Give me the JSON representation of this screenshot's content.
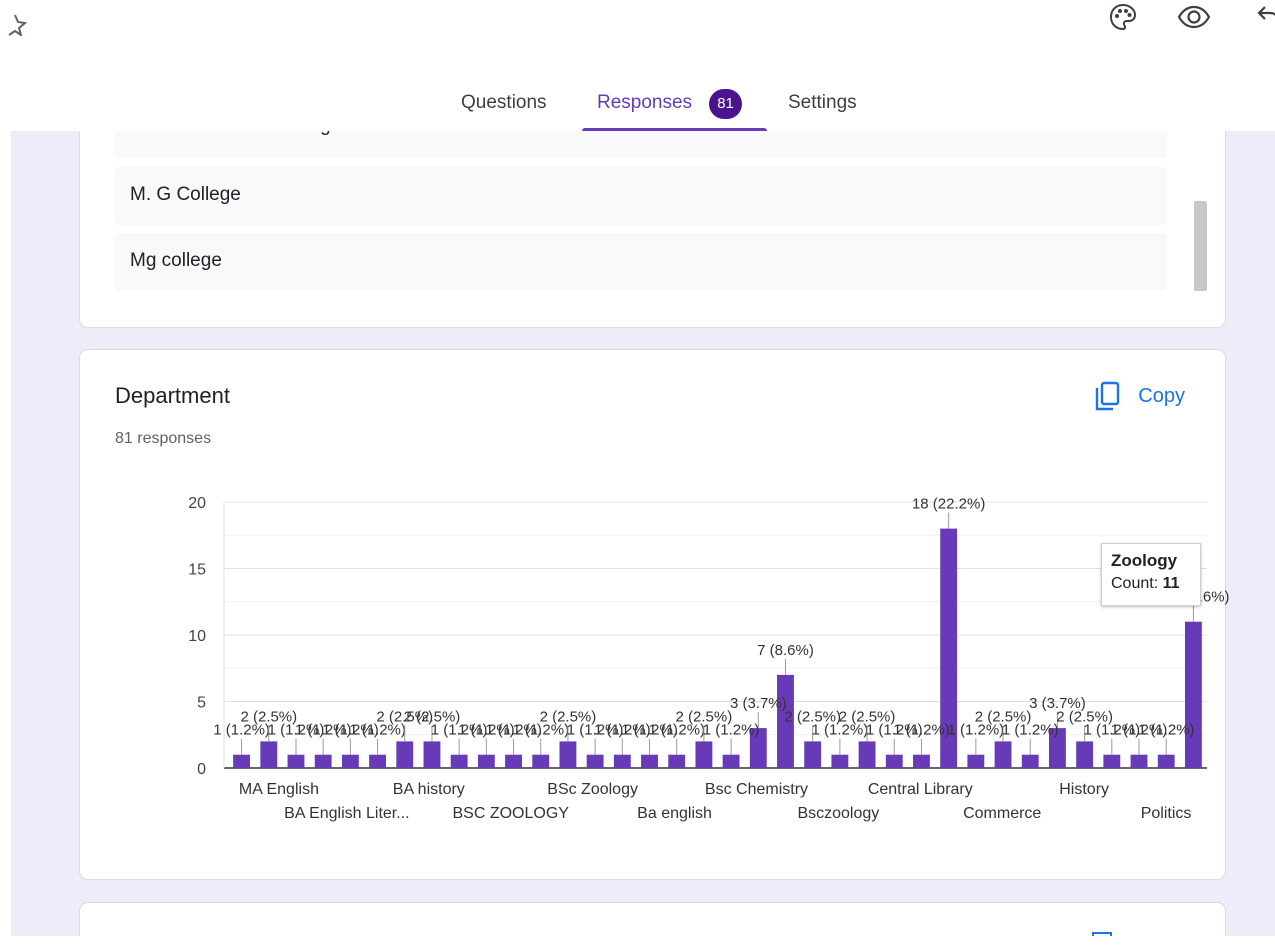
{
  "topbar": {
    "icons": [
      "star-outline-icon",
      "palette-icon",
      "eye-icon",
      "undo-icon"
    ]
  },
  "tabs": {
    "questions": "Questions",
    "responses": "Responses",
    "responses_count": "81",
    "settings": "Settings"
  },
  "college_answers": [
    "Mahatma Gandhi college",
    "M. G College",
    "Mg college"
  ],
  "department": {
    "title": "Department",
    "responses": "81 responses",
    "copy_label": "Copy"
  },
  "tooltip": {
    "title": "Zoology",
    "count_label": "Count:",
    "count": "11"
  },
  "colors": {
    "accent": "#673ab7",
    "bar": "#673ab7",
    "badge": "#4a148c",
    "link": "#1a73e8",
    "background": "#f0ebf8"
  },
  "chart_data": {
    "type": "bar",
    "ylim": [
      0,
      20
    ],
    "yticks": [
      "0",
      "5",
      "10",
      "15",
      "20"
    ],
    "categories": [
      "MA English",
      "BA English Liter...",
      "BA history",
      "BSC ZOOLOGY",
      "BSc Zoology",
      "Ba english",
      "Bsc Chemistry",
      "Bsczoology",
      "Central Library",
      "Commerce",
      "History",
      "Politics"
    ],
    "values": [
      1,
      2,
      1,
      1,
      1,
      1,
      2,
      2,
      1,
      1,
      1,
      1,
      2,
      1,
      1,
      1,
      1,
      2,
      1,
      3,
      7,
      2,
      1,
      2,
      1,
      1,
      18,
      1,
      2,
      1,
      3,
      2,
      1,
      1,
      1,
      11
    ],
    "data_labels": [
      "1 (1.2%)",
      "2 (2.5%)",
      "1 (1.2%)",
      "1 (1.2%)",
      "1 (1.2%)",
      "1 (1.2%)",
      "2 (2.5%)",
      "2 (2.5%)",
      "1 (1.2%)",
      "1 (1.2%)",
      "1 (1.2%)",
      "1 (1.2%)",
      "2 (2.5%)",
      "1 (1.2%)",
      "1 (1.2%)",
      "1 (1.2%)",
      "1 (1.2%)",
      "2 (2.5%)",
      "1 (1.2%)",
      "3 (3.7%)",
      "7 (8.6%)",
      "2 (2.5%)",
      "1 (1.2%)",
      "2 (2.5%)",
      "1 (1.2%)",
      "1 (1.2%)",
      "18 (22.2%)",
      "1 (1.2%)",
      "2 (2.5%)",
      "1 (1.2%)",
      "3 (3.7%)",
      "2 (2.5%)",
      "1 (1.2%)",
      "1 (1.2%)",
      "1 (1.2%)",
      "11 (13.6%)"
    ],
    "grid": true
  }
}
